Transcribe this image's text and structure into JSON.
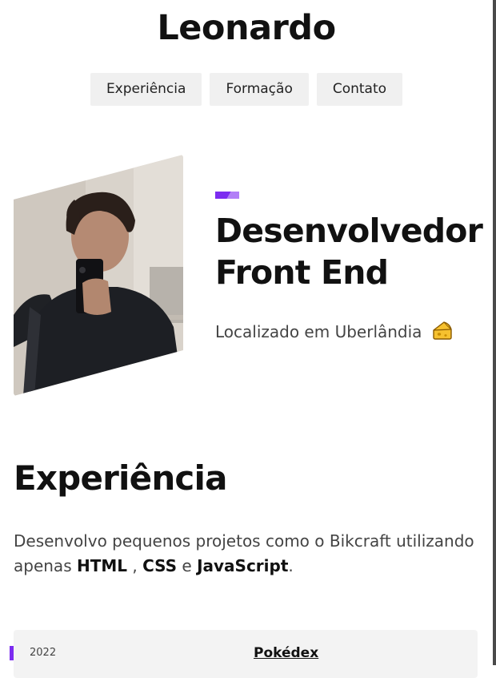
{
  "header": {
    "title": "Leonardo"
  },
  "nav": {
    "items": [
      {
        "label": "Experiência"
      },
      {
        "label": "Formação"
      },
      {
        "label": "Contato"
      }
    ]
  },
  "hero": {
    "title_line1": "Desenvolvedor",
    "title_line2": "Front End",
    "location": "Localizado em Uberlândia",
    "location_icon": "cheese-icon",
    "accent_color": "#7c2cf0"
  },
  "experience": {
    "title": "Experiência",
    "text_before": "Desenvolvo pequenos projetos como o Bikcraft utilizando apenas ",
    "tech1": "HTML",
    "sep1": " , ",
    "tech2": "CSS",
    "sep2": " e ",
    "tech3": "JavaScript",
    "text_after": ".",
    "project": {
      "year": "2022",
      "name": "Pokédex"
    }
  }
}
